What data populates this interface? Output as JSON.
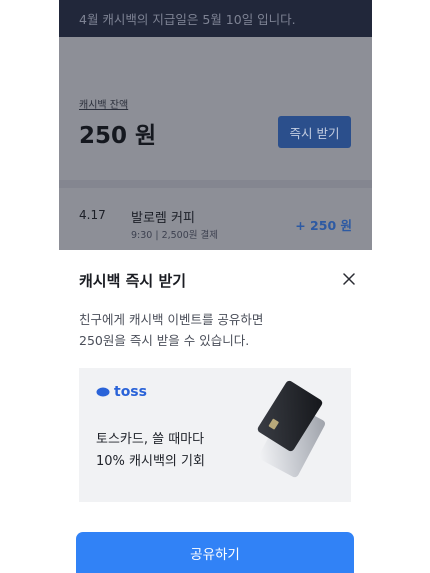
{
  "background": {
    "banner_text": "4월 캐시백의 지급일은 5월 10일 입니다.",
    "balance_label": "캐시백 잔액",
    "balance_amount": "250 원",
    "instant_button_label": "즉시 받기",
    "transaction": {
      "date": "4.17",
      "merchant": "발로렘 커피",
      "detail": "9:30 | 2,500원 결제",
      "amount": "+ 250 원"
    }
  },
  "sheet": {
    "title": "캐시백 즉시 받기",
    "close_icon": "close-icon",
    "description_line1": "친구에게 캐시백 이벤트를 공유하면",
    "description_line2": "250원을 즉시 받을 수 있습니다.",
    "promo": {
      "logo_text": "toss",
      "line1": "토스카드, 쓸 때마다",
      "line2": "10% 캐시백의 기회"
    },
    "share_button_label": "공유하기"
  },
  "colors": {
    "accent": "#3182f6",
    "banner_bg": "#21273a",
    "overlay": "#8d8f97",
    "amount_blue": "#2d5aa3"
  }
}
